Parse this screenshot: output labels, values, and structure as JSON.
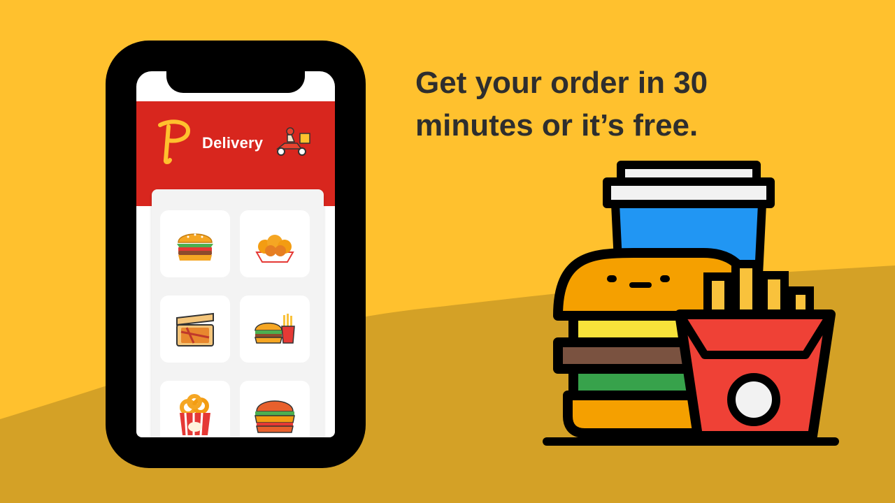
{
  "headline": {
    "line1": "Get your order in 30",
    "line2": "minutes or it’s free."
  },
  "app": {
    "title": "Delivery",
    "logo_letter": "P",
    "header_icon": "delivery-scooter-icon"
  },
  "menu": {
    "items": [
      {
        "icon": "burger-icon"
      },
      {
        "icon": "nuggets-icon"
      },
      {
        "icon": "pizza-box-icon"
      },
      {
        "icon": "burger-fries-combo-icon"
      },
      {
        "icon": "onion-rings-icon"
      },
      {
        "icon": "chicken-burger-icon"
      }
    ]
  },
  "colors": {
    "background": "#FFC12E",
    "wave": "#D4A126",
    "header": "#D8261E",
    "headline": "#2E2E2E"
  }
}
